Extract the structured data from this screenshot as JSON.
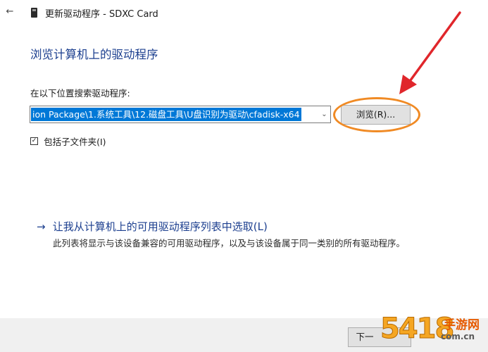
{
  "window": {
    "back_glyph": "←",
    "title": "更新驱动程序 - SDXC Card"
  },
  "page": {
    "heading": "浏览计算机上的驱动程序",
    "search_label": "在以下位置搜索驱动程序:",
    "path_value": "ion Package\\1.系统工具\\12.磁盘工具\\U盘识别为驱动\\cfadisk-x64",
    "combo_arrow": "⌄",
    "browse_label": "浏览(R)...",
    "include_subfolders_label": "包括子文件夹(I)",
    "include_subfolders_checked": true,
    "check_glyph": "✓",
    "pick_link_arrow": "→",
    "pick_link_label": "让我从计算机上的可用驱动程序列表中选取(L)",
    "pick_description": "此列表将显示与该设备兼容的可用驱动程序，以及与该设备属于同一类别的所有驱动程序。"
  },
  "footer": {
    "next_label": "下一"
  },
  "annotations": {
    "highlight_color": "#f08a24",
    "arrow_color": "#e0262b"
  },
  "watermark": {
    "number": "5418",
    "name": "手游网",
    "domain": "com.cn"
  }
}
